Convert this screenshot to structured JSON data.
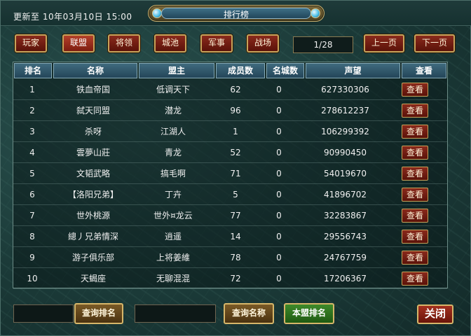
{
  "header": {
    "update_text": "更新至 10年03月10日 15:00",
    "title": "排行榜"
  },
  "tabs": [
    {
      "label": "玩家",
      "active": false
    },
    {
      "label": "联盟",
      "active": true
    },
    {
      "label": "将领",
      "active": false
    },
    {
      "label": "城池",
      "active": false
    },
    {
      "label": "军事",
      "active": false
    },
    {
      "label": "战场",
      "active": false
    }
  ],
  "pager": {
    "page": "1/28",
    "prev_label": "上一页",
    "next_label": "下一页"
  },
  "table": {
    "columns": [
      "排名",
      "名称",
      "盟主",
      "成员数",
      "名城数",
      "声望",
      "查看"
    ],
    "view_label": "查看",
    "rows": [
      [
        "1",
        "铁血帝国",
        "低调天下",
        "62",
        "0",
        "627330306"
      ],
      [
        "2",
        "弑天同盟",
        "潜龙",
        "96",
        "0",
        "278612237"
      ],
      [
        "3",
        "杀呀",
        "江湖人",
        "1",
        "0",
        "106299392"
      ],
      [
        "4",
        "雲夢山莊",
        "青龙",
        "52",
        "0",
        "90990450"
      ],
      [
        "5",
        "文韬武略",
        "搞毛啊",
        "71",
        "0",
        "54019670"
      ],
      [
        "6",
        "【洛阳兄弟】",
        "丁卉",
        "5",
        "0",
        "41896702"
      ],
      [
        "7",
        "世外桃源",
        "世外¤龙云",
        "77",
        "0",
        "32283867"
      ],
      [
        "8",
        "總丿兄弟情深",
        "逍遥",
        "14",
        "0",
        "29556743"
      ],
      [
        "9",
        "游子俱乐部",
        "上将姜維",
        "78",
        "0",
        "24767759"
      ],
      [
        "10",
        "天蝎座",
        "无聊混混",
        "72",
        "0",
        "17206367"
      ]
    ]
  },
  "footer": {
    "rank_input_value": "",
    "query_rank_label": "查询排名",
    "name_input_value": "",
    "query_name_label": "查询名称",
    "own_rank_label": "本盟排名",
    "close_label": "关闭"
  }
}
